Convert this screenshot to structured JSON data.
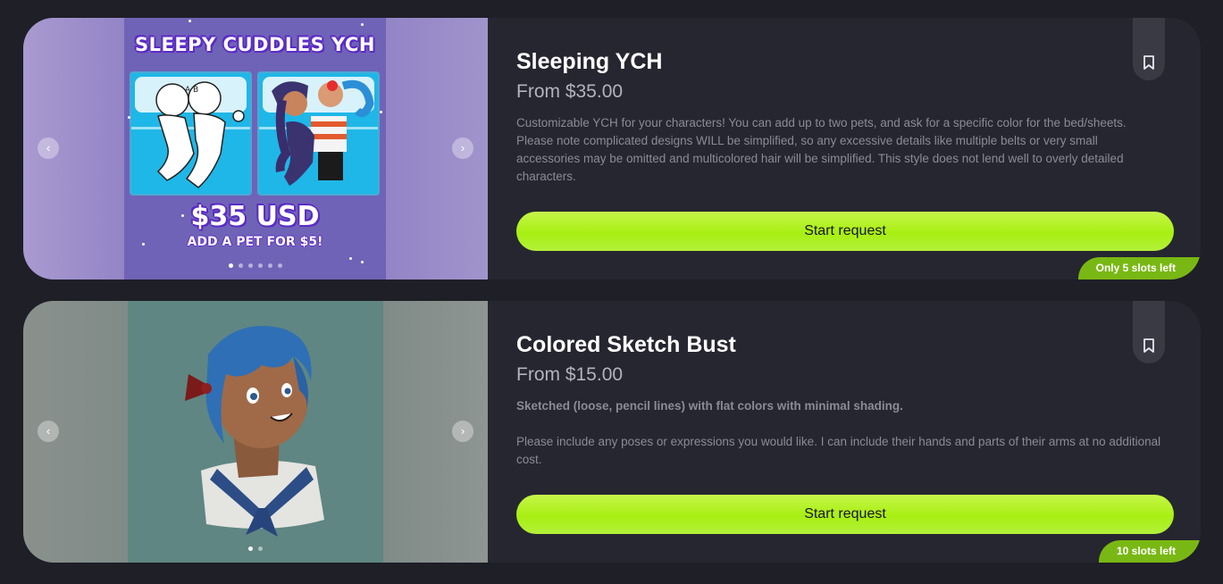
{
  "cards": [
    {
      "title": "Sleeping YCH",
      "price": "From $35.00",
      "description_bold": "",
      "description": "Customizable YCH for your characters! You can add up to two pets, and ask for a specific color for the bed/sheets. Please note complicated designs WILL be simplified, so any excessive details like multiple belts or very small accessories may be omitted and multicolored hair will be simplified. This style does not lend well to overly detailed characters.",
      "cta_label": "Start request",
      "slots_label": "Only 5 slots left",
      "image": {
        "title": "SLEEPY CUDDLES YCH",
        "price": "$35 USD",
        "sub": "ADD A PET FOR $5!",
        "panel_sketch_marks": "A B",
        "dots": 6,
        "active_dot": 0
      },
      "prev_icon": "chevron-left-icon",
      "next_icon": "chevron-right-icon",
      "bookmark_icon": "bookmark-icon"
    },
    {
      "title": "Colored Sketch Bust",
      "price": "From $15.00",
      "description_bold": "Sketched (loose, pencil lines) with flat colors with minimal shading.",
      "description": "Please include any poses or expressions you would like. I can include their hands and parts of their arms at no additional cost.",
      "cta_label": "Start request",
      "slots_label": "10 slots left",
      "image": {
        "dots": 2,
        "active_dot": 0
      },
      "prev_icon": "chevron-left-icon",
      "next_icon": "chevron-right-icon",
      "bookmark_icon": "bookmark-icon"
    }
  ],
  "colors": {
    "page_bg": "#1f1f27",
    "card_bg": "#262630",
    "accent_lime": "#b3f03a",
    "slots_badge": "#79b814"
  }
}
